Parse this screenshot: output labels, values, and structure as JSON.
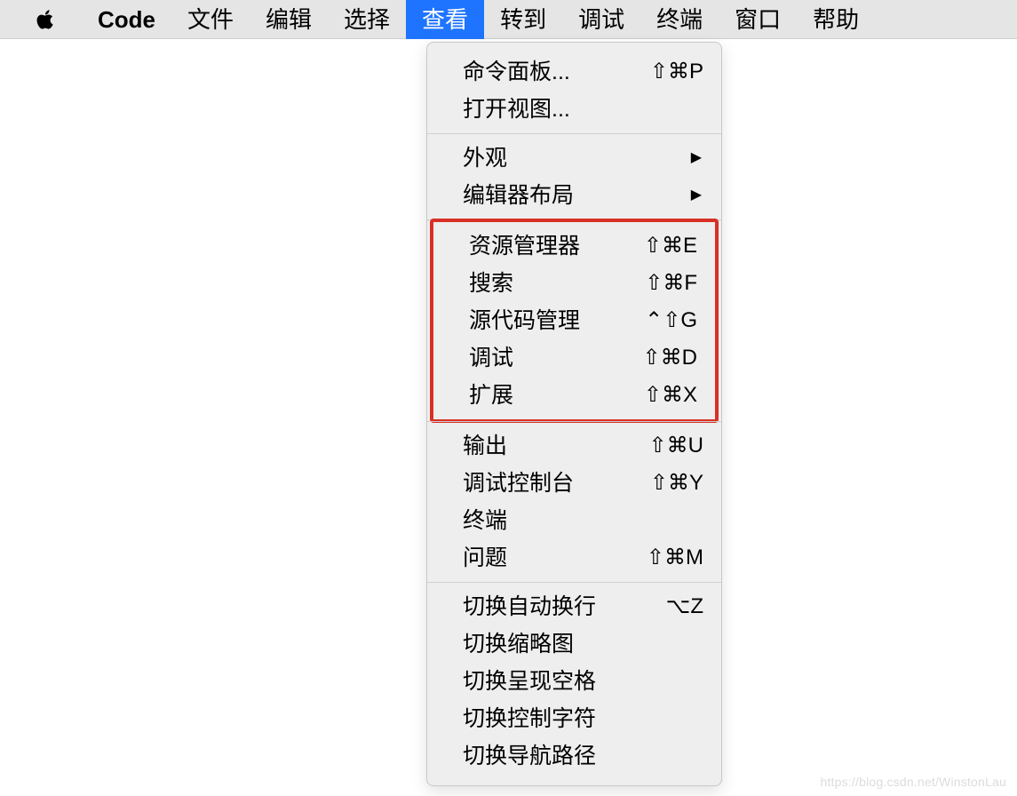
{
  "menubar": {
    "app_name": "Code",
    "items": [
      {
        "label": "文件"
      },
      {
        "label": "编辑"
      },
      {
        "label": "选择"
      },
      {
        "label": "查看",
        "active": true
      },
      {
        "label": "转到"
      },
      {
        "label": "调试"
      },
      {
        "label": "终端"
      },
      {
        "label": "窗口"
      },
      {
        "label": "帮助"
      }
    ]
  },
  "dropdown": {
    "section1": [
      {
        "label": "命令面板...",
        "shortcut": "⇧⌘P"
      },
      {
        "label": "打开视图...",
        "shortcut": ""
      }
    ],
    "section2": [
      {
        "label": "外观",
        "submenu": true
      },
      {
        "label": "编辑器布局",
        "submenu": true
      }
    ],
    "section3_highlighted": [
      {
        "label": "资源管理器",
        "shortcut": "⇧⌘E"
      },
      {
        "label": "搜索",
        "shortcut": "⇧⌘F"
      },
      {
        "label": "源代码管理",
        "shortcut": "⌃⇧G"
      },
      {
        "label": "调试",
        "shortcut": "⇧⌘D"
      },
      {
        "label": "扩展",
        "shortcut": "⇧⌘X"
      }
    ],
    "section4": [
      {
        "label": "输出",
        "shortcut": "⇧⌘U"
      },
      {
        "label": "调试控制台",
        "shortcut": "⇧⌘Y"
      },
      {
        "label": "终端",
        "shortcut": ""
      },
      {
        "label": "问题",
        "shortcut": "⇧⌘M"
      }
    ],
    "section5": [
      {
        "label": "切换自动换行",
        "shortcut": "⌥Z"
      },
      {
        "label": "切换缩略图",
        "shortcut": ""
      },
      {
        "label": "切换呈现空格",
        "shortcut": ""
      },
      {
        "label": "切换控制字符",
        "shortcut": ""
      },
      {
        "label": "切换导航路径",
        "shortcut": ""
      }
    ]
  },
  "watermark": "https://blog.csdn.net/WinstonLau"
}
